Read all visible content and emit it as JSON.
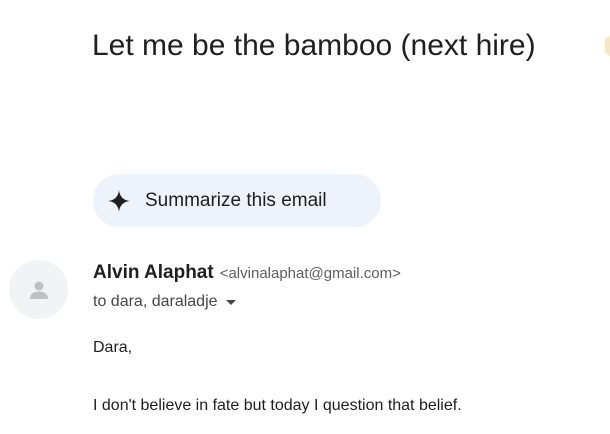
{
  "email": {
    "subject": "Let me be the bamboo (next hire)",
    "summarize_label": "Summarize this email",
    "sender_name": "Alvin Alaphat",
    "sender_email": "<alvinalaphat@gmail.com>",
    "recipients": "to dara, daraladje",
    "body": {
      "greeting": "Dara,",
      "paragraph_1": "I don't believe in fate but today I question that belief."
    }
  },
  "colors": {
    "summarize_bg": "#eef2fb",
    "avatar_bg": "#f1f3f4",
    "label_chip": "#f6e7c8"
  },
  "icons": {
    "summarize": "sparkle-icon",
    "avatar": "person-icon",
    "recipients_toggle": "caret-down-icon"
  }
}
